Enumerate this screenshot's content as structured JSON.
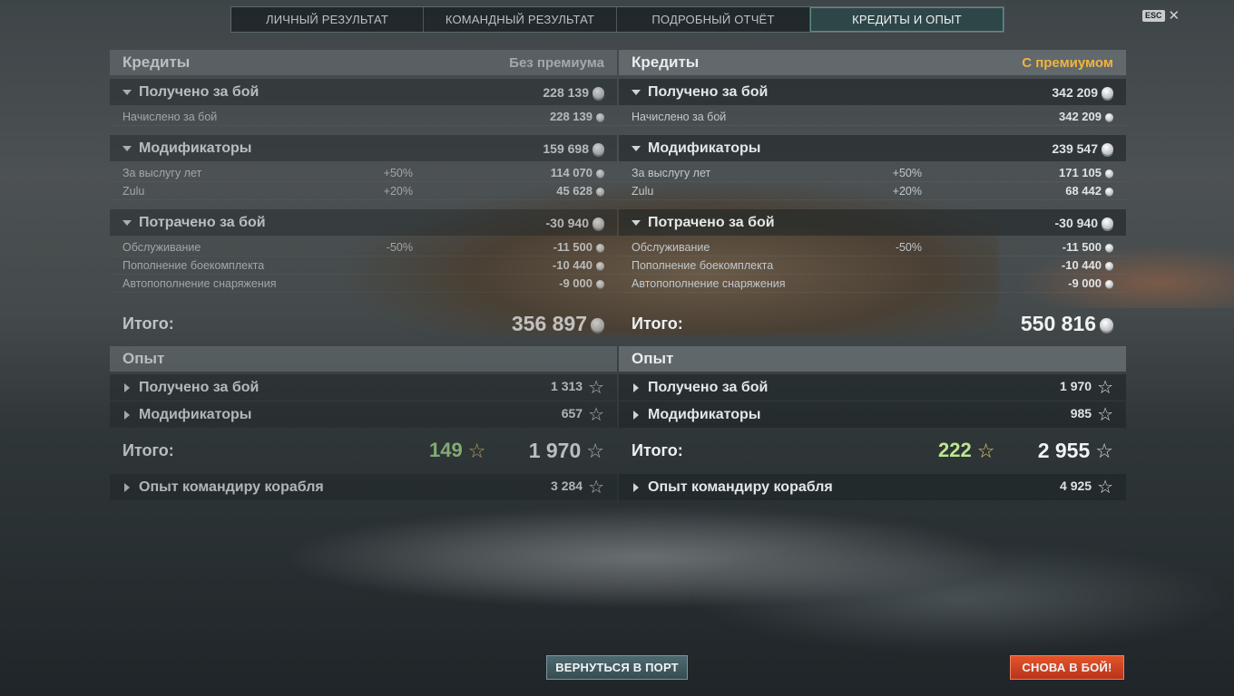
{
  "tabs": [
    "ЛИЧНЫЙ РЕЗУЛЬТАТ",
    "КОМАНДНЫЙ РЕЗУЛЬТАТ",
    "ПОДРОБНЫЙ ОТЧЁТ",
    "КРЕДИТЫ И ОПЫТ"
  ],
  "active_tab": "КРЕДИТЫ И ОПЫТ",
  "esc": {
    "key": "ESC",
    "close": "✕"
  },
  "panels": [
    {
      "credits_title": "Кредиты",
      "mode": "Без премиума",
      "earned": {
        "label": "Получено за бой",
        "value": "228 139",
        "items": [
          {
            "label": "Начислено за бой",
            "mult": "",
            "value": "228 139"
          }
        ]
      },
      "modifiers": {
        "label": "Модификаторы",
        "value": "159 698",
        "items": [
          {
            "label": "За выслугу лет",
            "mult": "+50%",
            "value": "114 070"
          },
          {
            "label": "Zulu",
            "mult": "+20%",
            "value": "45 628"
          }
        ]
      },
      "spent": {
        "label": "Потрачено за бой",
        "value": "-30 940",
        "items": [
          {
            "label": "Обслуживание",
            "mult": "-50%",
            "value": "-11 500"
          },
          {
            "label": "Пополнение боекомплекта",
            "mult": "",
            "value": "-10 440"
          },
          {
            "label": "Автопополнение снаряжения",
            "mult": "",
            "value": "-9 000"
          }
        ]
      },
      "credits_total": {
        "label": "Итого:",
        "value": "356 897"
      },
      "xp_title": "Опыт",
      "xp_earned": {
        "label": "Получено за бой",
        "value": "1 313"
      },
      "xp_modifiers": {
        "label": "Модификаторы",
        "value": "657"
      },
      "xp_total": {
        "label": "Итого:",
        "free_xp": "149",
        "value": "1 970"
      },
      "commander_xp": {
        "label": "Опыт командиру корабля",
        "value": "3 284"
      }
    },
    {
      "credits_title": "Кредиты",
      "mode": "С премиумом",
      "earned": {
        "label": "Получено за бой",
        "value": "342 209",
        "items": [
          {
            "label": "Начислено за бой",
            "mult": "",
            "value": "342 209"
          }
        ]
      },
      "modifiers": {
        "label": "Модификаторы",
        "value": "239 547",
        "items": [
          {
            "label": "За выслугу лет",
            "mult": "+50%",
            "value": "171 105"
          },
          {
            "label": "Zulu",
            "mult": "+20%",
            "value": "68 442"
          }
        ]
      },
      "spent": {
        "label": "Потрачено за бой",
        "value": "-30 940",
        "items": [
          {
            "label": "Обслуживание",
            "mult": "-50%",
            "value": "-11 500"
          },
          {
            "label": "Пополнение боекомплекта",
            "mult": "",
            "value": "-10 440"
          },
          {
            "label": "Автопополнение снаряжения",
            "mult": "",
            "value": "-9 000"
          }
        ]
      },
      "credits_total": {
        "label": "Итого:",
        "value": "550 816"
      },
      "xp_title": "Опыт",
      "xp_earned": {
        "label": "Получено за бой",
        "value": "1 970"
      },
      "xp_modifiers": {
        "label": "Модификаторы",
        "value": "985"
      },
      "xp_total": {
        "label": "Итого:",
        "free_xp": "222",
        "value": "2 955"
      },
      "commander_xp": {
        "label": "Опыт командиру корабля",
        "value": "4 925"
      }
    }
  ],
  "buttons": {
    "port": "ВЕРНУТЬСЯ В ПОРТ",
    "battle": "СНОВА В БОЙ!"
  },
  "colors": {
    "premium_tag": "#f2b33d",
    "free_xp": "#bde690",
    "battle_button": "#d9451f",
    "port_button": "#45616a"
  }
}
